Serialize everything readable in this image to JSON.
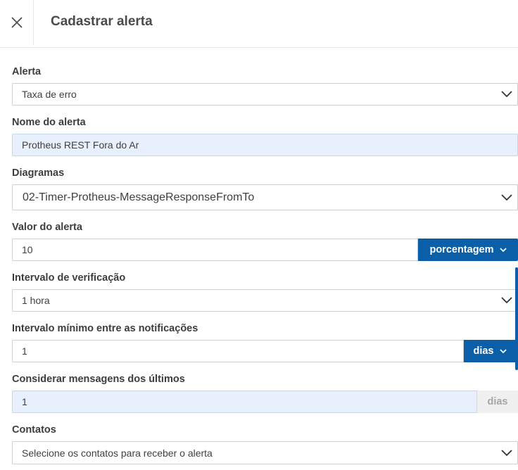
{
  "header": {
    "title": "Cadastrar alerta",
    "close_icon": "close-icon"
  },
  "form": {
    "alerta": {
      "label": "Alerta",
      "value": "Taxa de erro"
    },
    "nome": {
      "label": "Nome do alerta",
      "value": "Protheus REST Fora do Ar"
    },
    "diagramas": {
      "label": "Diagramas",
      "value": "02-Timer-Protheus-MessageResponseFromTo"
    },
    "valor": {
      "label": "Valor do alerta",
      "value": "10",
      "unit": "porcentagem"
    },
    "intervalo": {
      "label": "Intervalo de verificação",
      "value": "1 hora"
    },
    "intervalo_min": {
      "label": "Intervalo mínimo entre as notificações",
      "value": "1",
      "unit": "dias"
    },
    "considerar": {
      "label": "Considerar mensagens dos últimos",
      "value": "1",
      "unit": "dias"
    },
    "contatos": {
      "label": "Contatos",
      "placeholder": "Selecione os contatos para receber o alerta"
    }
  },
  "colors": {
    "primary": "#0b5ea8",
    "input_highlight": "#e8f0fe",
    "border": "#cfcfcf"
  }
}
